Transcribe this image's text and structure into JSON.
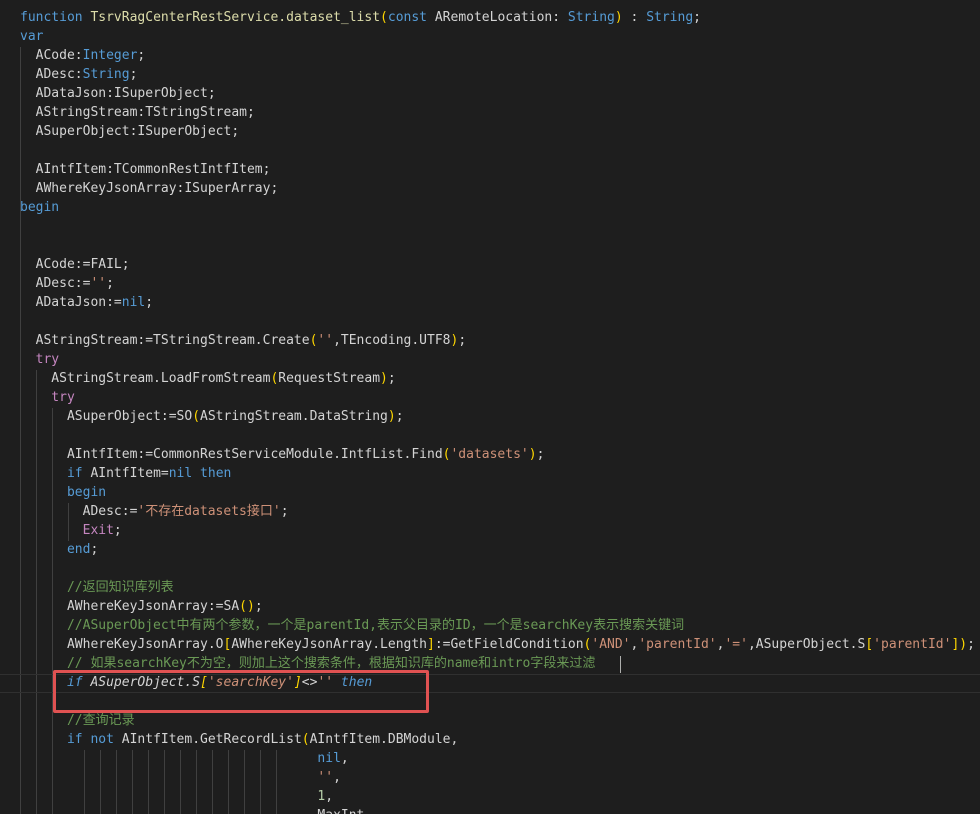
{
  "editor": {
    "lines": [
      [
        [
          "kw",
          "function "
        ],
        [
          "fn",
          "TsrvRagCenterRestService.dataset_list"
        ],
        [
          "br",
          "("
        ],
        [
          "kw",
          "const "
        ],
        [
          "",
          "ARemoteLocation: "
        ],
        [
          "kw",
          "String"
        ],
        [
          "br",
          ")"
        ],
        [
          "",
          " : "
        ],
        [
          "kw",
          "String"
        ],
        [
          "",
          ";"
        ]
      ],
      [
        [
          "kw",
          "var"
        ]
      ],
      [
        [
          "",
          "  ACode:"
        ],
        [
          "kw",
          "Integer"
        ],
        [
          "",
          ";"
        ]
      ],
      [
        [
          "",
          "  ADesc:"
        ],
        [
          "kw",
          "String"
        ],
        [
          "",
          ";"
        ]
      ],
      [
        [
          "",
          "  ADataJson:ISuperObject;"
        ]
      ],
      [
        [
          "",
          "  AStringStream:TStringStream;"
        ]
      ],
      [
        [
          "",
          "  ASuperObject:ISuperObject;"
        ]
      ],
      [],
      [
        [
          "",
          "  AIntfItem:TCommonRestIntfItem;"
        ]
      ],
      [
        [
          "",
          "  AWhereKeyJsonArray:ISuperArray;"
        ]
      ],
      [
        [
          "kw",
          "begin"
        ]
      ],
      [],
      [],
      [
        [
          "",
          "  ACode:=FAIL;"
        ]
      ],
      [
        [
          "",
          "  ADesc:="
        ],
        [
          "str",
          "''"
        ],
        [
          "",
          ";"
        ]
      ],
      [
        [
          "",
          "  ADataJson:="
        ],
        [
          "kw",
          "nil"
        ],
        [
          "",
          ";"
        ]
      ],
      [],
      [
        [
          "",
          "  AStringStream:=TStringStream.Create"
        ],
        [
          "br",
          "("
        ],
        [
          "str",
          "''"
        ],
        [
          "",
          ",TEncoding.UTF8"
        ],
        [
          "br",
          ")"
        ],
        [
          "",
          ";"
        ]
      ],
      [
        [
          "kw2",
          "  try"
        ]
      ],
      [
        [
          "",
          "    AStringStream.LoadFromStream"
        ],
        [
          "br",
          "("
        ],
        [
          "",
          "RequestStream"
        ],
        [
          "br",
          ")"
        ],
        [
          "",
          ";"
        ]
      ],
      [
        [
          "kw2",
          "    try"
        ]
      ],
      [
        [
          "",
          "      ASuperObject:=SO"
        ],
        [
          "br",
          "("
        ],
        [
          "",
          "AStringStream.DataString"
        ],
        [
          "br",
          ")"
        ],
        [
          "",
          ";"
        ]
      ],
      [],
      [
        [
          "",
          "      AIntfItem:=CommonRestServiceModule.IntfList.Find"
        ],
        [
          "br",
          "("
        ],
        [
          "str",
          "'datasets'"
        ],
        [
          "br",
          ")"
        ],
        [
          "",
          ";"
        ]
      ],
      [
        [
          "kw",
          "      if "
        ],
        [
          "",
          "AIntfItem="
        ],
        [
          "kw",
          "nil "
        ],
        [
          "kw",
          "then"
        ]
      ],
      [
        [
          "kw",
          "      begin"
        ]
      ],
      [
        [
          "",
          "        ADesc:="
        ],
        [
          "str",
          "'不存在datasets接口'"
        ],
        [
          "",
          ";"
        ]
      ],
      [
        [
          "kw2",
          "        Exit"
        ],
        [
          "",
          ";"
        ]
      ],
      [
        [
          "kw",
          "      end"
        ],
        [
          "",
          ";"
        ]
      ],
      [],
      [
        [
          "cm",
          "      //返回知识库列表"
        ]
      ],
      [
        [
          "",
          "      AWhereKeyJsonArray:=SA"
        ],
        [
          "br",
          "()"
        ],
        [
          "",
          ";"
        ]
      ],
      [
        [
          "cm",
          "      //ASuperObject中有两个参数，一个是parentId,表示父目录的ID，一个是searchKey表示搜索关键词"
        ]
      ],
      [
        [
          "",
          "      AWhereKeyJsonArray.O"
        ],
        [
          "br",
          "["
        ],
        [
          "",
          "AWhereKeyJsonArray.Length"
        ],
        [
          "br",
          "]"
        ],
        [
          "",
          ":=GetFieldCondition"
        ],
        [
          "br",
          "("
        ],
        [
          "str",
          "'AND'"
        ],
        [
          "",
          ","
        ],
        [
          "str",
          "'parentId'"
        ],
        [
          "",
          ","
        ],
        [
          "str",
          "'='"
        ],
        [
          "",
          ",ASuperObject.S"
        ],
        [
          "br",
          "["
        ],
        [
          "str",
          "'parentId'"
        ],
        [
          "br",
          "]"
        ],
        [
          "br",
          ")"
        ],
        [
          "",
          ";"
        ]
      ],
      [
        [
          "cm",
          "      // 如果searchKey不为空，则加上这个搜索条件，根据知识库的name和intro字段来过滤"
        ]
      ],
      [
        [
          "kw it",
          "      if "
        ],
        [
          "it",
          "ASuperObject.S"
        ],
        [
          "br it",
          "["
        ],
        [
          "str it",
          "'searchKey'"
        ],
        [
          "br it",
          "]"
        ],
        [
          "it",
          "<>"
        ],
        [
          "str it",
          "''"
        ],
        [
          "kw it",
          " then"
        ]
      ],
      [],
      [
        [
          "cm",
          "      //查询记录"
        ]
      ],
      [
        [
          "kw",
          "      if "
        ],
        [
          "kw",
          "not "
        ],
        [
          "",
          "AIntfItem.GetRecordList"
        ],
        [
          "br",
          "("
        ],
        [
          "",
          "AIntfItem.DBModule,"
        ]
      ],
      [
        [
          "kw",
          "                                      nil"
        ],
        [
          "",
          ","
        ]
      ],
      [
        [
          "str",
          "                                      ''"
        ],
        [
          "",
          ","
        ]
      ],
      [
        [
          "num",
          "                                      1"
        ],
        [
          "",
          ","
        ]
      ],
      [
        [
          "",
          "                                      MaxInt,"
        ]
      ]
    ]
  }
}
